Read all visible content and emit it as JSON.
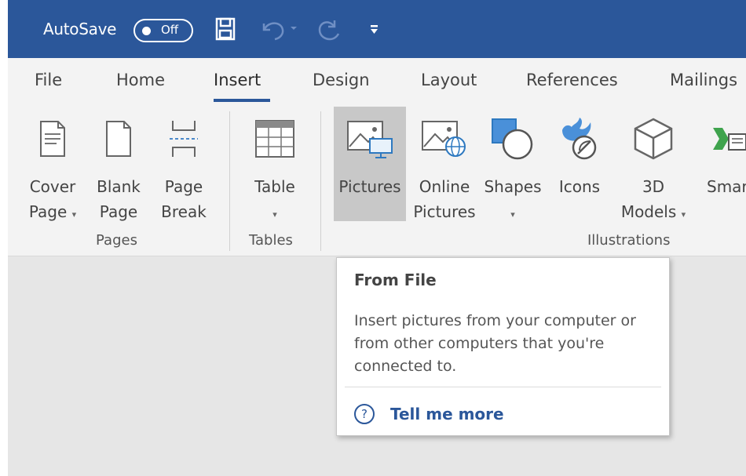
{
  "titlebar": {
    "autosave_label": "AutoSave",
    "autosave_state": "Off",
    "icons": [
      "save-icon",
      "undo-icon",
      "redo-icon",
      "customize-quick-access-icon"
    ],
    "accent_color": "#2b579a"
  },
  "tabs": [
    {
      "label": "File"
    },
    {
      "label": "Home"
    },
    {
      "label": "Insert",
      "active": true
    },
    {
      "label": "Design"
    },
    {
      "label": "Layout"
    },
    {
      "label": "References"
    },
    {
      "label": "Mailings"
    }
  ],
  "ribbon": {
    "groups": {
      "pages": "Pages",
      "tables": "Tables",
      "illustrations": "Illustrations"
    },
    "buttons": {
      "cover_page": {
        "line1": "Cover",
        "line2": "Page",
        "caret": "▾"
      },
      "blank_page": {
        "line1": "Blank",
        "line2": "Page"
      },
      "page_break": {
        "line1": "Page",
        "line2": "Break"
      },
      "table": {
        "line1": "Table",
        "caret": "▾"
      },
      "pictures": {
        "line1": "Pictures"
      },
      "online_pictures": {
        "line1": "Online",
        "line2": "Pictures"
      },
      "shapes": {
        "line1": "Shapes",
        "caret": "▾"
      },
      "icons": {
        "line1": "Icons"
      },
      "models_3d": {
        "line1": "3D",
        "line2": "Models",
        "caret": "▾"
      },
      "smartart": {
        "line1": "Smart"
      }
    }
  },
  "tooltip": {
    "title": "From File",
    "body": "Insert pictures from your computer or from other computers that you're connected to.",
    "help_icon": "?",
    "help_link": "Tell me more"
  }
}
